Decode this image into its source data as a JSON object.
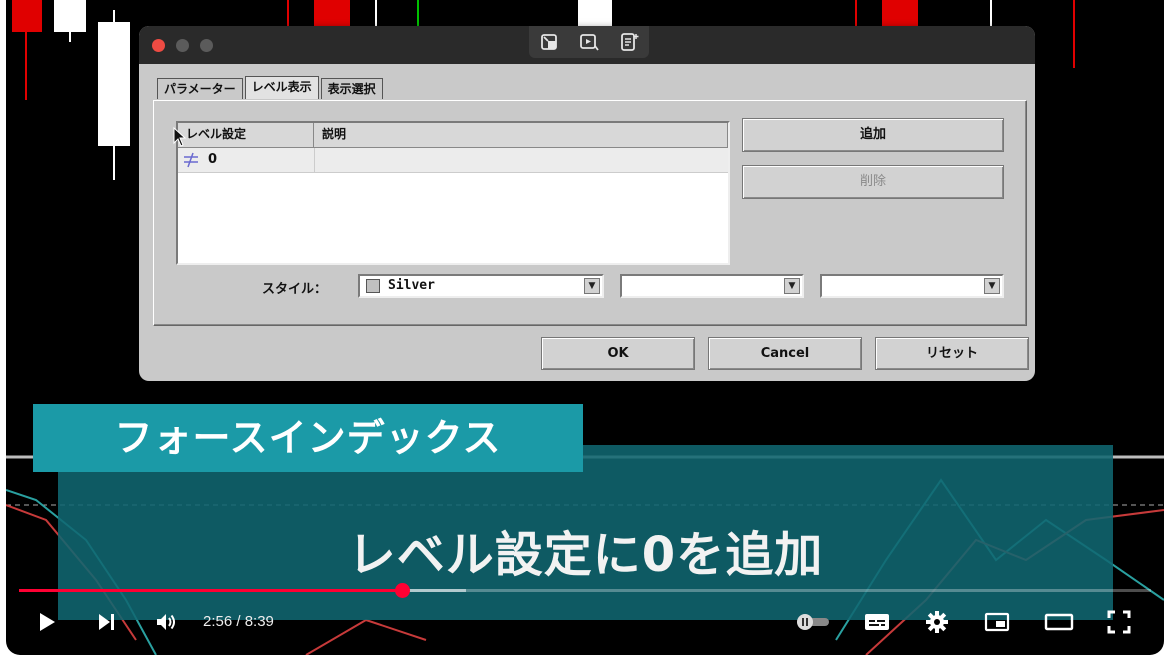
{
  "dialog": {
    "tabs": [
      {
        "label": "パラメーター",
        "active": false
      },
      {
        "label": "レベル表示",
        "active": true
      },
      {
        "label": "表示選択",
        "active": false
      }
    ],
    "levels_table": {
      "columns": [
        "レベル設定",
        "説明"
      ],
      "rows": [
        {
          "level": "0",
          "description": ""
        }
      ]
    },
    "buttons": {
      "add": "追加",
      "delete": "削除",
      "ok": "OK",
      "cancel": "Cancel",
      "reset": "リセット"
    },
    "style": {
      "label": "スタイル：",
      "color_value": "Silver",
      "color_hex": "#c0c0c0"
    }
  },
  "captions": {
    "indicator_name": "フォースインデックス",
    "instruction": "レベル設定に0を追加"
  },
  "player": {
    "time_display": "2:56 / 8:39",
    "progress_fraction": 0.339,
    "buffer_fraction": 0.395
  },
  "colors": {
    "caption_band_light": "#1b9aa7",
    "caption_band_dark": "#106771",
    "progress_red": "#ff0033",
    "traffic_close": "#ee4b43"
  },
  "icons": {
    "tool_1": "pip-toggle-icon",
    "tool_2": "screenshot-video-icon",
    "tool_3": "notes-add-icon",
    "play": "play-icon",
    "next": "next-icon",
    "volume": "volume-icon",
    "autoplay": "autoplay-toggle-icon",
    "subtitles": "subtitles-icon",
    "settings": "settings-gear-icon",
    "miniplayer": "miniplayer-icon",
    "theater": "theater-mode-icon",
    "fullscreen": "fullscreen-icon"
  }
}
